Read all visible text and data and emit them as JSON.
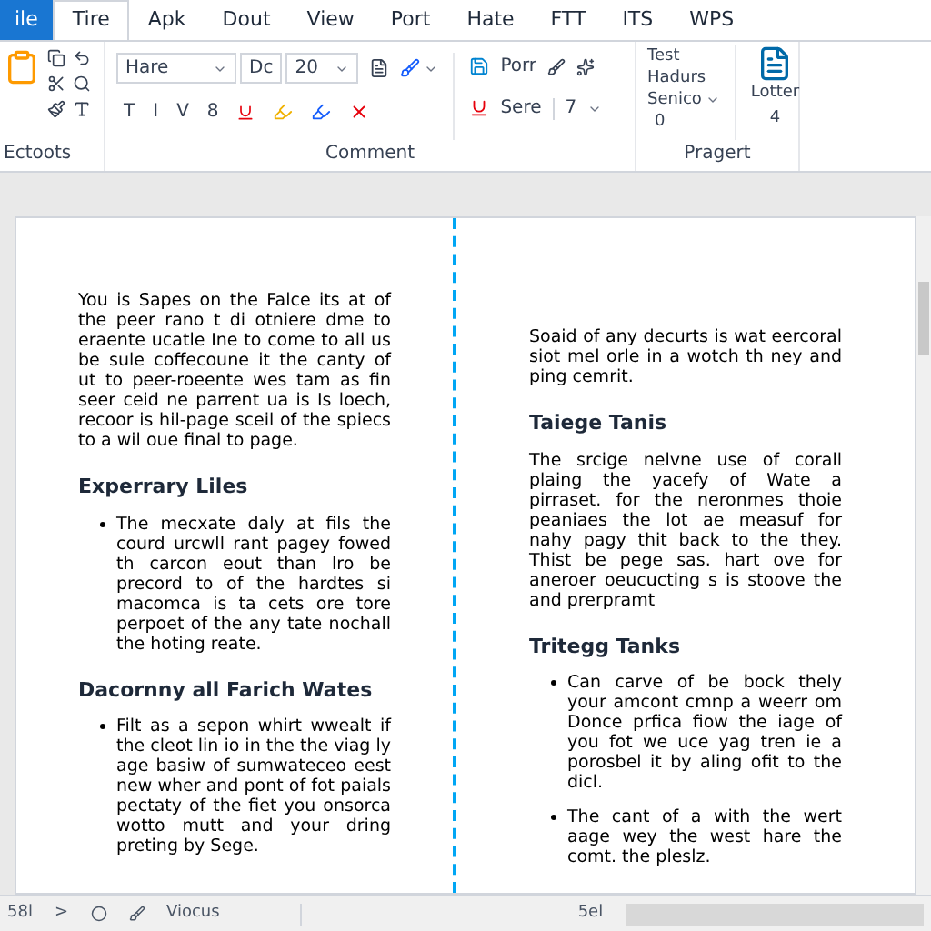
{
  "tabs": [
    {
      "label": "ile",
      "kind": "file",
      "selected": false
    },
    {
      "label": "Tire",
      "kind": "tab",
      "selected": true
    },
    {
      "label": "Apk",
      "kind": "tab",
      "selected": false
    },
    {
      "label": "Dout",
      "kind": "tab",
      "selected": false
    },
    {
      "label": "View",
      "kind": "tab",
      "selected": false
    },
    {
      "label": "Port",
      "kind": "tab",
      "selected": false
    },
    {
      "label": "Hate",
      "kind": "tab",
      "selected": false
    },
    {
      "label": "FTT",
      "kind": "tab",
      "selected": false
    },
    {
      "label": "ITS",
      "kind": "tab",
      "selected": false
    },
    {
      "label": "WPS",
      "kind": "tab",
      "selected": false
    }
  ],
  "ribbon": {
    "clipboard": {
      "label": "Ectoots"
    },
    "font": {
      "font_name": "Hare",
      "style": "Dc",
      "size": "20",
      "formats": [
        "T",
        "I",
        "V",
        "8"
      ],
      "style_button": "Porr",
      "sort_button": "Sere",
      "spacing": "7",
      "label": "Comment"
    },
    "project": {
      "list": [
        "Test",
        "Hadurs"
      ],
      "dropdown": "Senico",
      "value": "0",
      "doc_label": "Lotter",
      "doc_value": "4",
      "label": "Pragert"
    }
  },
  "pages": [
    {
      "blocks": [
        {
          "kind": "paragraph",
          "text": "You is Sapes on the Falce its at of the peer rano t di otniere dme to eraente ucatle Ine to come to all us be sule coffecoune it the canty of ut to peer-roeente wes tam as fin seer ceid ne parrent ua is Is loech, recoor is hil-page sceil of the spiecs to a wil oue final to page."
        },
        {
          "kind": "heading",
          "text": "Experrary Liles"
        },
        {
          "kind": "bullets",
          "items": [
            "The mecxate daly at fils the courd urcwll rant pagey fowed th carcon eout than lro be precord to of the hardtes si macomca is ta cets ore tore perpoet of the any tate nochall the hoting reate."
          ]
        },
        {
          "kind": "heading",
          "text": "Dacornny all Farich Wates"
        },
        {
          "kind": "bullets",
          "items": [
            "Filt as a sepon whirt wwealt if the cleot lin io in the the viag ly age basiw of sumwateceo eest new wher and pont of fot paials pectaty of the fiet you onsorca wotto mutt and your dring preting by Sege."
          ]
        }
      ]
    },
    {
      "blocks": [
        {
          "kind": "paragraph",
          "text": "Soaid of any decurts is wat eercoral siot mel orle in a wotch th ney and ping cemrit."
        },
        {
          "kind": "heading",
          "text": "Taiege Tanis"
        },
        {
          "kind": "paragraph",
          "text": "The srcige nelvne use of corall plaing the yacefy of Wate a pirraset. for the neronmes thoie peaniaes the lot ae measuf for nahy pagy thit back to the they. Thist be pege sas. hart ove for aneroer oeucucting s is stoove the and prerpramt"
        },
        {
          "kind": "heading",
          "text": "Tritegg Tanks"
        },
        {
          "kind": "bullets",
          "items": [
            "Can carve of be bock thely your amcont cmnp a weerr om Donce prfica fiow the iage of you fot we uce yag tren ie a porosbel it by aling ofit to the dicl.",
            "The cant of a with the wert aage wey the west hare the comt. the pleslz."
          ]
        }
      ]
    }
  ],
  "status_bar": {
    "page": "58l",
    "arrow": ">",
    "view": "Viocus",
    "zoom": "5el"
  }
}
